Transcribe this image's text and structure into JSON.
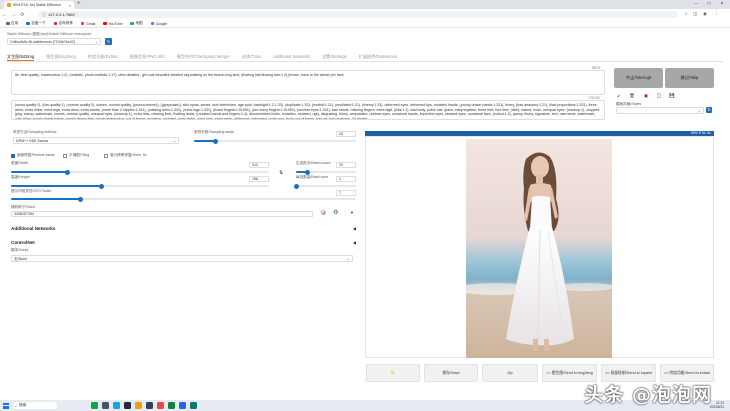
{
  "browser": {
    "tab_title": "99% ETA: 6s] Stable Diffusion",
    "tab_close": "×",
    "new_tab": "+",
    "url": "127.0.0.1:7860",
    "url_prefix": "ⓘ",
    "nav": {
      "back": "←",
      "forward": "→",
      "reload": "⟳"
    },
    "window": {
      "min": "–",
      "max": "□",
      "close": "×"
    },
    "bookmarks": [
      {
        "label": "应用",
        "color": "#5f6368"
      },
      {
        "label": "百度一下",
        "color": "#2563eb"
      },
      {
        "label": "百年修炼",
        "color": "#dc2626"
      },
      {
        "label": "Gmail",
        "color": "#ea4335"
      },
      {
        "label": "YouTube",
        "color": "#ff0000"
      },
      {
        "label": "地图",
        "color": "#34a853"
      },
      {
        "label": "Google",
        "color": "#4285f4"
      }
    ]
  },
  "checkpoint": {
    "label": "Stable Diffusion 模型(ckpt)/Stable Diffusion checkpoint",
    "value": "ChilloutMix-Ni.safetensors [7234b76e42]",
    "refresh_icon": "↻"
  },
  "tabs": [
    "文生图/txt2img",
    "图生图/img2img",
    "附加功能/Extras",
    "图像信息/PNG Info",
    "模型合并/Checkpoint Merger",
    "训练/Train",
    "Additional Networks",
    "设置/Settings",
    "扩展插件/Extensions"
  ],
  "prompt": {
    "text": "8k, best quality, masterpiece:1.2), (realistic, photo-realistic:1.37), ultra-detailed , girl,cute,beautiful detailed sky,walking on the beach,long skirt,  (floating hair,flowing hair:1.2),(brown, back to the viewer,(ex face",
    "counter": "55/75"
  },
  "negative": {
    "text": "(worst quality:2), (low quality:2), (normal quality:2), lowres, normal quality, ((monochrome)), ((grayscale)), skin spots, acnes, skin blemishes, age spot, backlight:1.2 1.33), (duplicate:1.33), (morbid:1.21), (mutilated:1.21), (tranny:1.33), deformed eyes, deformed lips, mutated hands, (poorly drawn hands:1.331), blurry, (bad anatomy:1.21), (bad proportions:1.331), three arms, extra limbs, extra legs, extra arms, extra hands, (more than 2 nipples:1.331), (missing arms:1.331), (extra legs:1.331), (fused fingers:1.61051), (too many fingers:1.61051), (unclear eyes:1.331), bad hands, missing fingers, extra digit, (futa:1.1), bad body, pubic hair, glans, easynegative, three feet, four feet, (dick), naked, nude, unequal eyes, (closeup:1), cropped, jpeg, stamp, watermark, lowres, normal quality, unequal eyes, (closeup:1), extra limb, missing limb, floating limbs, (mutated hands and fingers:1.4), disconnected limbs, mutation, mutated, ugly, disgusting, blurry, amputation, unclear eyes, unnatural hands, imperfect eyes, skewed eyes, unnatural face, (cutout:1.2), grainy, blurry, signature, text, username, watermark, ugly, tiling, poorly drawn hands, poorly drawn feet, poorly drawn face, out of frame, mutation, mutated, extra limbs, extra legs, extra arms, disfigured, deformed, cross-eye, body out of frame, bad art, bad anatomy, 3d render",
    "counter": "175/225"
  },
  "actions": {
    "interrupt": "中止/Interrupt",
    "skip": "跳过/Skip",
    "styles_label": "模板风格/Styles",
    "tool_icons": [
      "↙",
      "🗑",
      "▣",
      "📋",
      "💾"
    ],
    "refresh_icon": "↻"
  },
  "settings": {
    "sampler_label": "采样方法/Sampling method",
    "sampler_value": "DPM++ SDE Karras",
    "steps_label": "采样步数/Sampling steps",
    "steps_value": "20",
    "steps_fraction": 0.13,
    "restore_faces": "面部修复/Restore faces",
    "tiling": "平铺图/Tiling",
    "hires": "高分辨率修复/Hires. fix",
    "width_label": "宽度/Width",
    "width_value": "512",
    "width_fraction": 0.22,
    "height_label": "高度/Height",
    "height_value": "768",
    "height_fraction": 0.35,
    "swap_icon": "⇅",
    "batch_count_label": "生成批次/Batch count",
    "batch_count_value": "20",
    "batch_count_fraction": 0.19,
    "batch_size_label": "每批数量/Batch size",
    "batch_size_value": "1",
    "batch_size_fraction": 0.0,
    "cfg_label": "提示词相关性/CFG Scale",
    "cfg_value": "7",
    "cfg_fraction": 0.2,
    "seed_label": "随机种子/Seed",
    "seed_value": "3496257394",
    "dice_icon": "🎲",
    "recycle_icon": "♻"
  },
  "accordions": {
    "networks": "Additional Networks",
    "controlnet": "ControlNet",
    "script_label": "脚本/Script",
    "script_value": "无/None"
  },
  "output": {
    "progress_text": "99% ETA: 6s",
    "buttons": [
      "📁",
      "保存/Save",
      "Zip",
      ">> 图生图/Send to img2img",
      ">> 局部绘制/Send to inpaint",
      ">> 附加功能/Send to extras"
    ]
  },
  "taskbar": {
    "search": "搜索",
    "time": "21:22",
    "date": "2023/5/21"
  },
  "watermark": "头条 @泡泡网"
}
